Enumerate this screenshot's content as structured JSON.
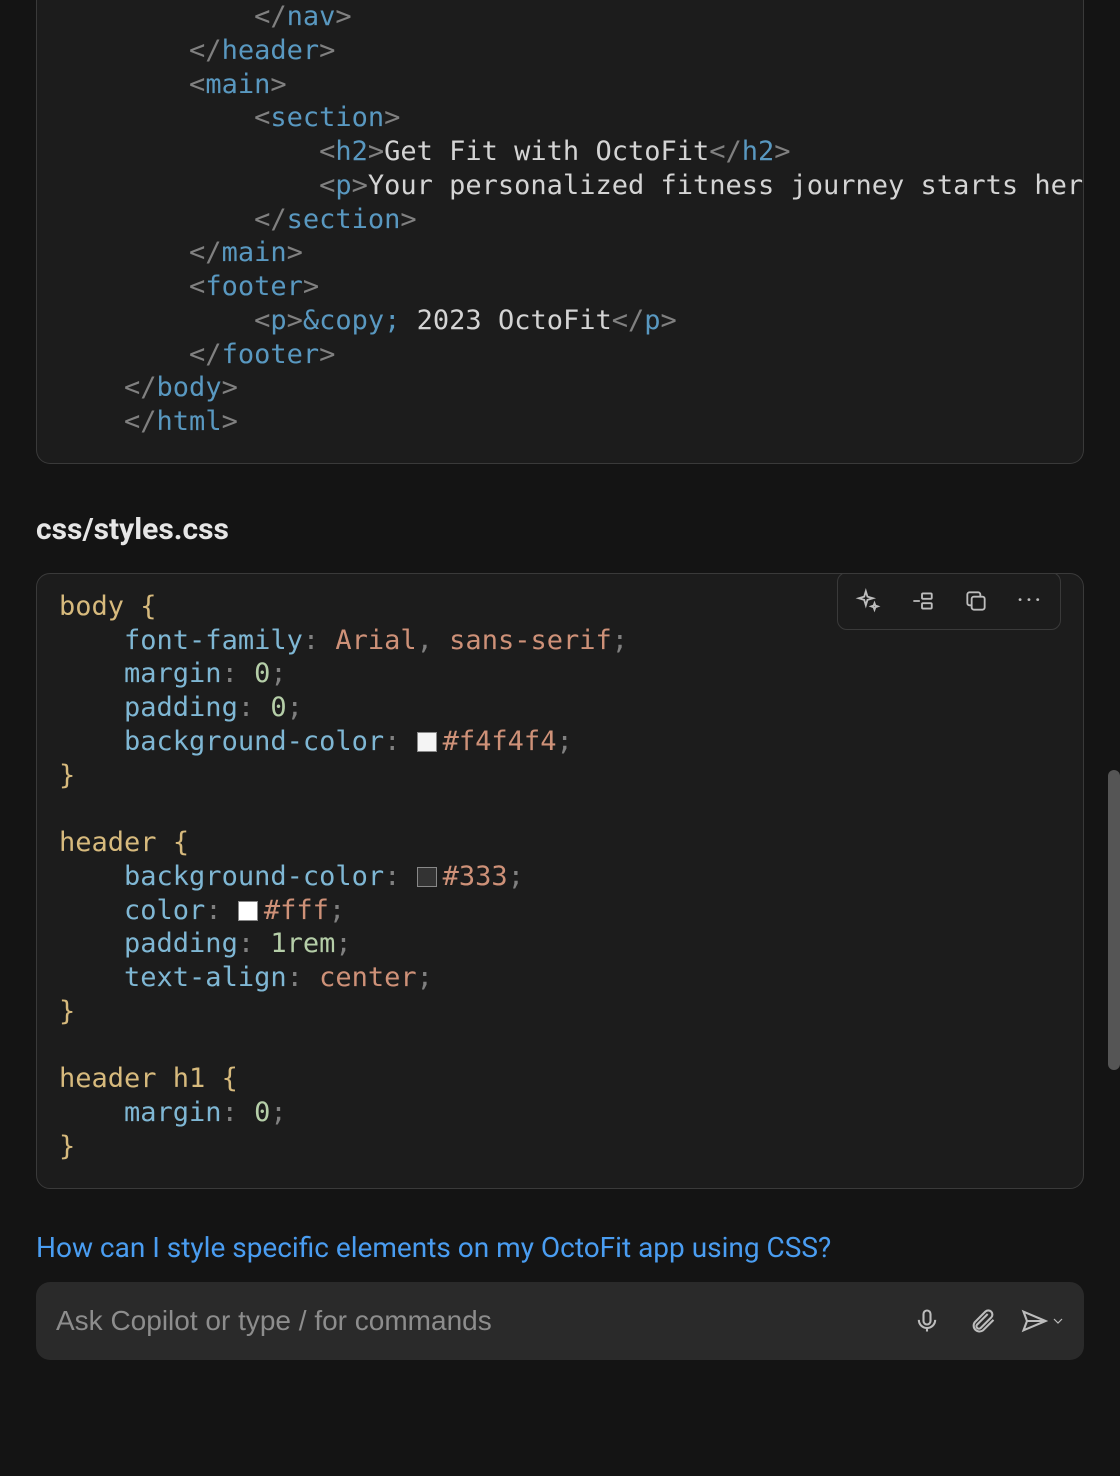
{
  "html_code": {
    "h2_text": "Get Fit with OctoFit",
    "p_text": "Your personalized fitness journey starts here.",
    "footer_entity": "&copy;",
    "footer_text": " 2023 OctoFit",
    "tags": {
      "nav": "nav",
      "header": "header",
      "main": "main",
      "section": "section",
      "h2": "h2",
      "p": "p",
      "footer": "footer",
      "body": "body",
      "html": "html"
    }
  },
  "css_heading": "css/styles.css",
  "css_code": {
    "body": {
      "selector": "body",
      "font_family_prop": "font-family",
      "font_family_val1": "Arial",
      "font_family_val2": " sans-serif",
      "margin_prop": "margin",
      "margin_val": "0",
      "padding_prop": "padding",
      "padding_val": "0",
      "bg_prop": "background-color",
      "bg_val": "#f4f4f4",
      "bg_swatch": "#f4f4f4"
    },
    "header": {
      "selector": "header",
      "bg_prop": "background-color",
      "bg_val": "#333",
      "bg_swatch": "#333333",
      "color_prop": "color",
      "color_val": "#fff",
      "color_swatch": "#ffffff",
      "padding_prop": "padding",
      "padding_val": "1rem",
      "ta_prop": "text-align",
      "ta_val": "center"
    },
    "header_h1": {
      "selector": "header h1",
      "margin_prop": "margin",
      "margin_val": "0"
    }
  },
  "suggestion_link": "How can I style specific elements on my OctoFit app using CSS?",
  "chat": {
    "placeholder": "Ask Copilot or type / for commands"
  }
}
